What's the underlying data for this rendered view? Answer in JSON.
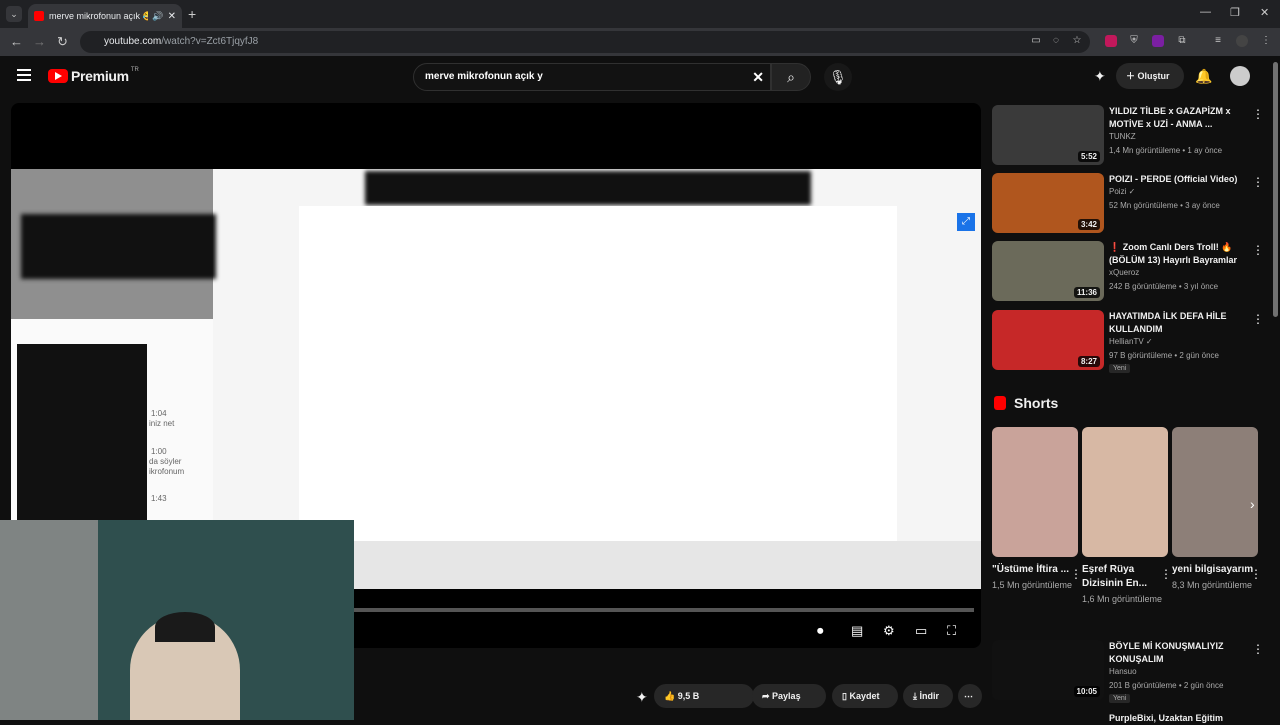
{
  "browser": {
    "tab_title": "merve mikrofonun açık 😂",
    "url_host": "youtube.com",
    "url_path": "/watch?v=Zct6TjqyfJ8"
  },
  "youtube": {
    "logo": "Premium",
    "region": "TR",
    "search_value": "merve mikrofonun açık y",
    "create_label": "Oluştur"
  },
  "stream": {
    "chat_lines": [
      "1:04",
      "iniz net",
      "1:00",
      "da söyler",
      "ikrofonum",
      "1:43"
    ]
  },
  "actions": {
    "likes": "9,5 B",
    "share": "Paylaş",
    "save": "Kaydet",
    "download": "İndir"
  },
  "recommended": [
    {
      "title": "YILDIZ TİLBE x GAZAPİZM x MOTİVE x UZİ - ANMA ...",
      "channel": "TUNKZ",
      "meta": "1,4 Mn görüntüleme • 1 ay önce",
      "duration": "5:52",
      "color": "#3a3a3a"
    },
    {
      "title": "POIZI - PERDE (Official Video)",
      "channel": "Poizi ✓",
      "meta": "52 Mn görüntüleme • 3 ay önce",
      "duration": "3:42",
      "color": "#b0561e"
    },
    {
      "title": "❗ Zoom Canlı Ders Troll! 🔥 (BÖLÜM 13) Hayırlı Bayramlar",
      "channel": "xQueroz",
      "meta": "242 B görüntüleme • 3 yıl önce",
      "duration": "11:36",
      "color": "#6b6a5a"
    },
    {
      "title": "HAYATIMDA İLK DEFA HİLE KULLANDIM",
      "channel": "HellianTV ✓",
      "meta": "97 B görüntüleme • 2 gün önce",
      "duration": "8:27",
      "badge": "Yeni",
      "color": "#c62828"
    },
    {
      "title": "BÖYLE Mİ KONUŞMALIYIZ KONUŞALIM",
      "channel": "Hansuo",
      "meta": "201 B görüntüleme • 2 gün önce",
      "duration": "10:05",
      "badge": "Yeni",
      "color": "#111111"
    }
  ],
  "shorts": {
    "header": "Shorts",
    "items": [
      {
        "title": "\"Üstüme İftira ...",
        "views": "1,5 Mn görüntüleme",
        "color": "#c9a39a"
      },
      {
        "title": "Eşref Rüya Dizisinin En...",
        "views": "1,6 Mn görüntüleme",
        "color": "#d7b8a4"
      },
      {
        "title": "yeni bilgisayarım",
        "views": "8,3 Mn görüntüleme",
        "color": "#8d7f78"
      }
    ]
  },
  "partial_next": "PurpleBixi, Uzaktan Eğitim"
}
